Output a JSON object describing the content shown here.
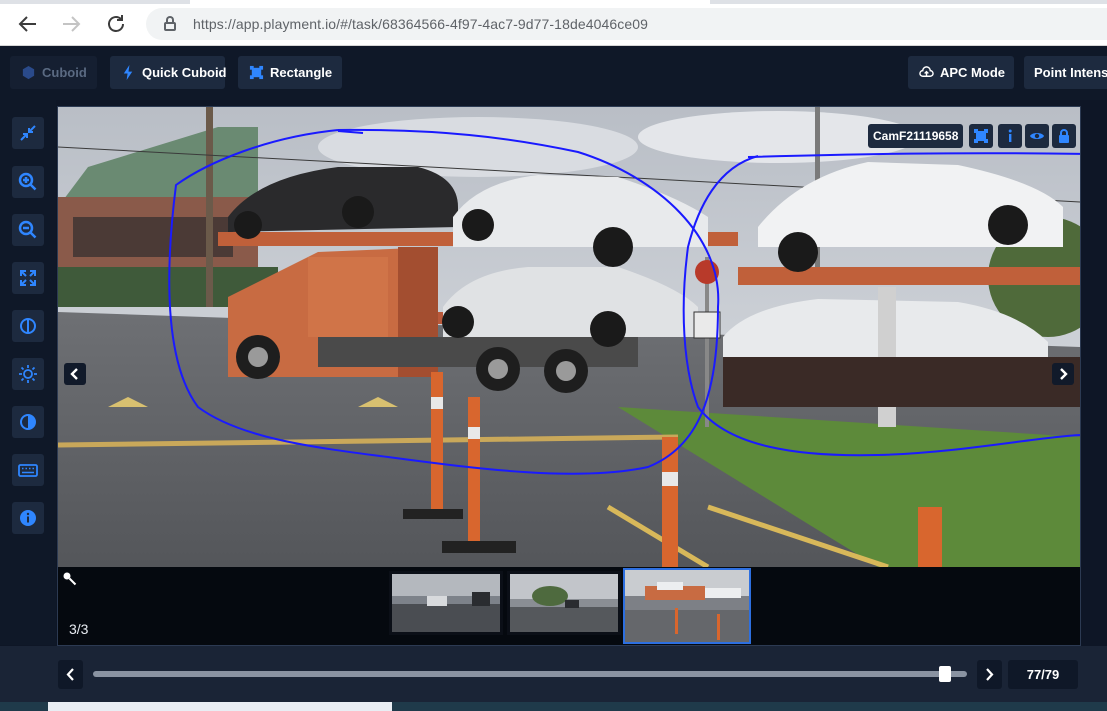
{
  "browser": {
    "url": "https://app.playment.io/#/task/68364566-4f97-4ac7-9d77-18de4046ce09",
    "back_icon": "arrow-left-icon",
    "forward_icon": "arrow-right-icon",
    "reload_icon": "reload-icon"
  },
  "toolbar": {
    "cuboid_label": "Cuboid",
    "quick_cuboid_label": "Quick Cuboid",
    "rectangle_label": "Rectangle",
    "apc_mode_label": "APC Mode",
    "point_intensity_label": "Point Intensit"
  },
  "left_rail": {
    "items": [
      {
        "icon": "collapse-icon"
      },
      {
        "icon": "zoom-in-icon"
      },
      {
        "icon": "zoom-out-icon"
      },
      {
        "icon": "fit-screen-icon"
      },
      {
        "icon": "split-view-icon"
      },
      {
        "icon": "brightness-icon"
      },
      {
        "icon": "contrast-icon"
      },
      {
        "icon": "keyboard-icon"
      },
      {
        "icon": "info-icon"
      }
    ]
  },
  "viewer": {
    "camera_label": "CamF21119658",
    "frame_counter": "3/3",
    "accent_color": "#1a6cf0",
    "annotation_color": "#1a1aff"
  },
  "timeline": {
    "position_label": "77/79",
    "current_frame": 77,
    "total_frames": 79
  }
}
